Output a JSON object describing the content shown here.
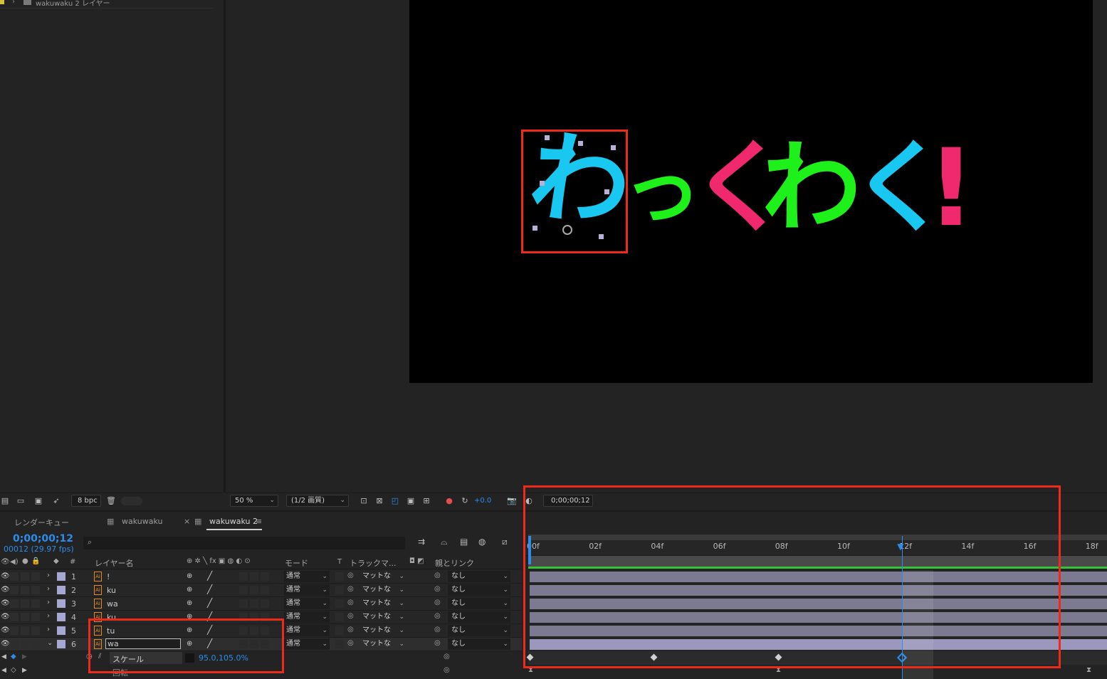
{
  "project": {
    "item_label": "wakuwaku 2 レイヤー"
  },
  "composition": {
    "characters": [
      {
        "text": "わ",
        "color": "#19c8f0"
      },
      {
        "text": "っ",
        "color": "#1ef01a"
      },
      {
        "text": "く",
        "color": "#f0286e"
      },
      {
        "text": "わ",
        "color": "#1ef01a"
      },
      {
        "text": "く",
        "color": "#19c8f0"
      },
      {
        "text": "!",
        "color": "#f0286e"
      }
    ]
  },
  "project_toolbar": {
    "bpc": "8 bpc"
  },
  "viewer_toolbar": {
    "zoom": "50 %",
    "resolution": "(1/2 画質)",
    "exposure": "+0.0",
    "timecode": "0;00;00;12"
  },
  "tabs": {
    "render_queue": "レンダーキュー",
    "comp1": "wakuwaku",
    "comp2": "wakuwaku 2"
  },
  "timeline": {
    "current_time": "0;00;00;12",
    "frame_info": "00012 (29.97 fps)",
    "headers": {
      "num": "#",
      "layer_name": "レイヤー名",
      "mode": "モード",
      "t": "T",
      "track_matte": "トラックマ...",
      "parent": "親とリンク"
    },
    "layers": [
      {
        "num": "1",
        "name": "!",
        "mode": "通常",
        "matte": "マットな",
        "parent": "なし"
      },
      {
        "num": "2",
        "name": "ku",
        "mode": "通常",
        "matte": "マットな",
        "parent": "なし"
      },
      {
        "num": "3",
        "name": "wa",
        "mode": "通常",
        "matte": "マットな",
        "parent": "なし"
      },
      {
        "num": "4",
        "name": "ku",
        "mode": "通常",
        "matte": "マットな",
        "parent": "なし"
      },
      {
        "num": "5",
        "name": "tu",
        "mode": "通常",
        "matte": "マットな",
        "parent": "なし"
      },
      {
        "num": "6",
        "name": "wa",
        "mode": "通常",
        "matte": "マットな",
        "parent": "なし"
      }
    ],
    "property": {
      "name": "スケール",
      "value": "95.0,105.0%"
    },
    "property2": {
      "name": "回転"
    },
    "ruler": [
      "00f",
      "02f",
      "04f",
      "06f",
      "08f",
      "10f",
      "12f",
      "14f",
      "16f",
      "18f"
    ],
    "playhead_frame": 12,
    "accent_color": "#2d8ceb",
    "highlight_color": "#ee2a1b"
  }
}
